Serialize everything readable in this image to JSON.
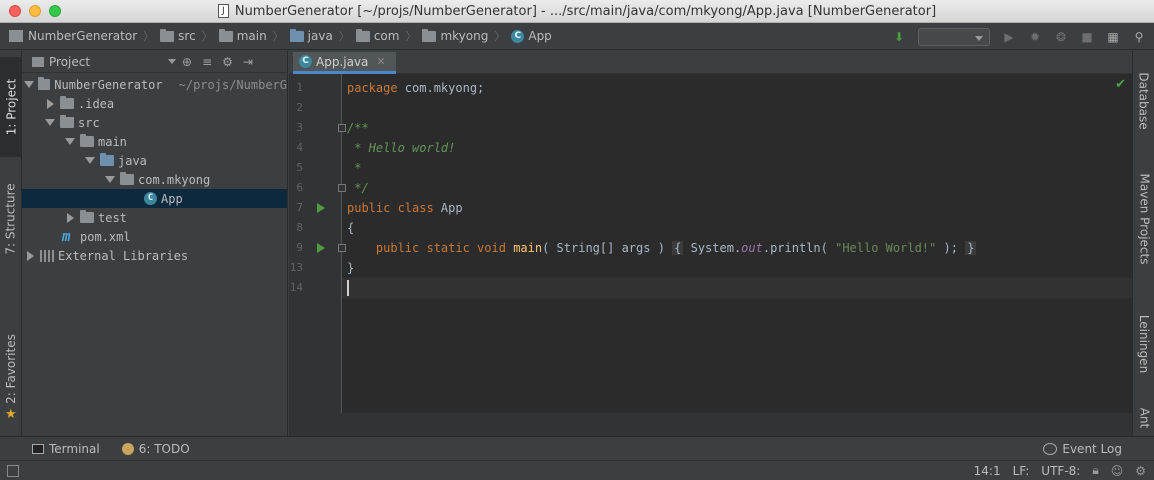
{
  "window": {
    "title": "NumberGenerator [~/projs/NumberGenerator] - .../src/main/java/com/mkyong/App.java [NumberGenerator]",
    "title_icon": "J"
  },
  "breadcrumb": [
    {
      "label": "NumberGenerator",
      "icon": "project-icon"
    },
    {
      "label": "src",
      "icon": "folder-icon"
    },
    {
      "label": "main",
      "icon": "folder-icon"
    },
    {
      "label": "java",
      "icon": "source-folder-icon"
    },
    {
      "label": "com",
      "icon": "package-icon"
    },
    {
      "label": "mkyong",
      "icon": "package-icon"
    },
    {
      "label": "App",
      "icon": "class-icon"
    }
  ],
  "left_strip": {
    "project": "1: Project",
    "structure": "7: Structure",
    "favorites": "2: Favorites"
  },
  "project_panel": {
    "title": "Project",
    "tree": [
      {
        "label": "NumberGenerator",
        "note": "~/projs/NumberG",
        "arrow": "down",
        "icon": "project-folder-icon",
        "depth": 0
      },
      {
        "label": ".idea",
        "arrow": "right",
        "icon": "folder-icon",
        "depth": 1
      },
      {
        "label": "src",
        "arrow": "down",
        "icon": "folder-icon",
        "depth": 1
      },
      {
        "label": "main",
        "arrow": "down",
        "icon": "folder-icon",
        "depth": 2
      },
      {
        "label": "java",
        "arrow": "down",
        "icon": "source-folder-icon",
        "depth": 3
      },
      {
        "label": "com.mkyong",
        "arrow": "down",
        "icon": "package-icon",
        "depth": 4
      },
      {
        "label": "App",
        "arrow": "none",
        "icon": "class-icon",
        "depth": 5,
        "selected": true
      },
      {
        "label": "test",
        "arrow": "right",
        "icon": "folder-icon",
        "depth": 2
      },
      {
        "label": "pom.xml",
        "arrow": "none",
        "icon": "maven-icon",
        "depth": 1
      },
      {
        "label": "External Libraries",
        "arrow": "right",
        "icon": "library-icon",
        "depth": 0
      }
    ]
  },
  "editor": {
    "tab_label": "App.java",
    "line_numbers": [
      "1",
      "2",
      "3",
      "4",
      "5",
      "6",
      "7",
      "8",
      "9",
      "13",
      "14"
    ],
    "code": {
      "l1_kw": "package",
      "l1_rest": " com.mkyong;",
      "l3": "/**",
      "l4": " * Hello world!",
      "l5": " *",
      "l6": " */",
      "l7_kw": "public class",
      "l7_rest": " App",
      "l8": "{",
      "l9_indent": "    ",
      "l9_kw": "public static void",
      "l9_fn": "main",
      "l9_args": "( String[] args ) ",
      "l9_open": "{",
      "l9_sys": " System.",
      "l9_out": "out",
      "l9_print": ".println( ",
      "l9_str": "\"Hello World!\"",
      "l9_end": " );",
      "l9_close": "}",
      "l13": "}"
    }
  },
  "right_strip": {
    "database": "Database",
    "maven": "Maven Projects",
    "leiningen": "Leiningen",
    "ant": "Ant"
  },
  "bottom_tools": {
    "terminal": "Terminal",
    "todo": "6: TODO",
    "event_log": "Event Log"
  },
  "status": {
    "position": "14:1",
    "line_sep": "LF:",
    "encoding": "UTF-8:"
  },
  "colors": {
    "keyword": "#cc7832",
    "comment": "#629755",
    "string": "#6a8759",
    "method": "#ffc66d",
    "field": "#9876aa",
    "selection": "#0d293e",
    "tab_accent": "#4a88c7"
  }
}
